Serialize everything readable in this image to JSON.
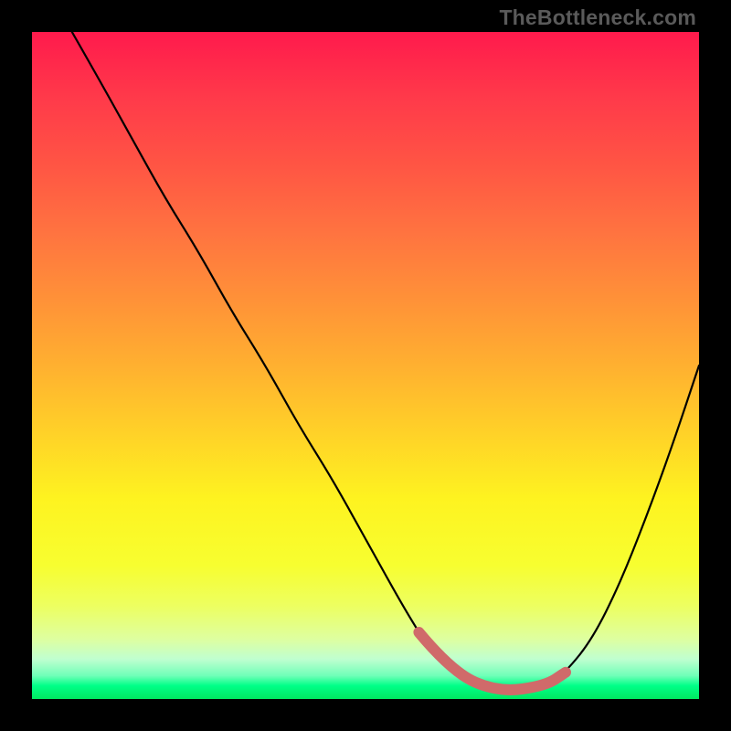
{
  "attribution": "TheBottleneck.com",
  "colors": {
    "background": "#000000",
    "gradient_top": "#ff1a4c",
    "gradient_mid": "#ffd128",
    "gradient_bottom": "#00e860",
    "curve": "#000000",
    "accent": "#d06a6a",
    "attribution_text": "#5a5a5a"
  },
  "chart_data": {
    "type": "line",
    "title": "",
    "xlabel": "",
    "ylabel": "",
    "xlim": [
      0,
      100
    ],
    "ylim": [
      100,
      0
    ],
    "series": [
      {
        "name": "bottleneck-curve",
        "x": [
          6,
          10,
          15,
          20,
          25,
          30,
          35,
          40,
          45,
          50,
          55,
          58,
          60,
          63,
          66,
          70,
          74,
          77,
          80,
          84,
          88,
          92,
          96,
          100
        ],
        "y": [
          0,
          7,
          16,
          25,
          33,
          42,
          50,
          59,
          67,
          76,
          85,
          90,
          93,
          96,
          98,
          99,
          99,
          98,
          96,
          91,
          83,
          73,
          62,
          50
        ]
      },
      {
        "name": "optimal-range-highlight",
        "x": [
          58,
          63,
          70,
          77,
          80
        ],
        "y": [
          90,
          96,
          99,
          98,
          96
        ]
      }
    ],
    "grid": false,
    "legend": false
  }
}
